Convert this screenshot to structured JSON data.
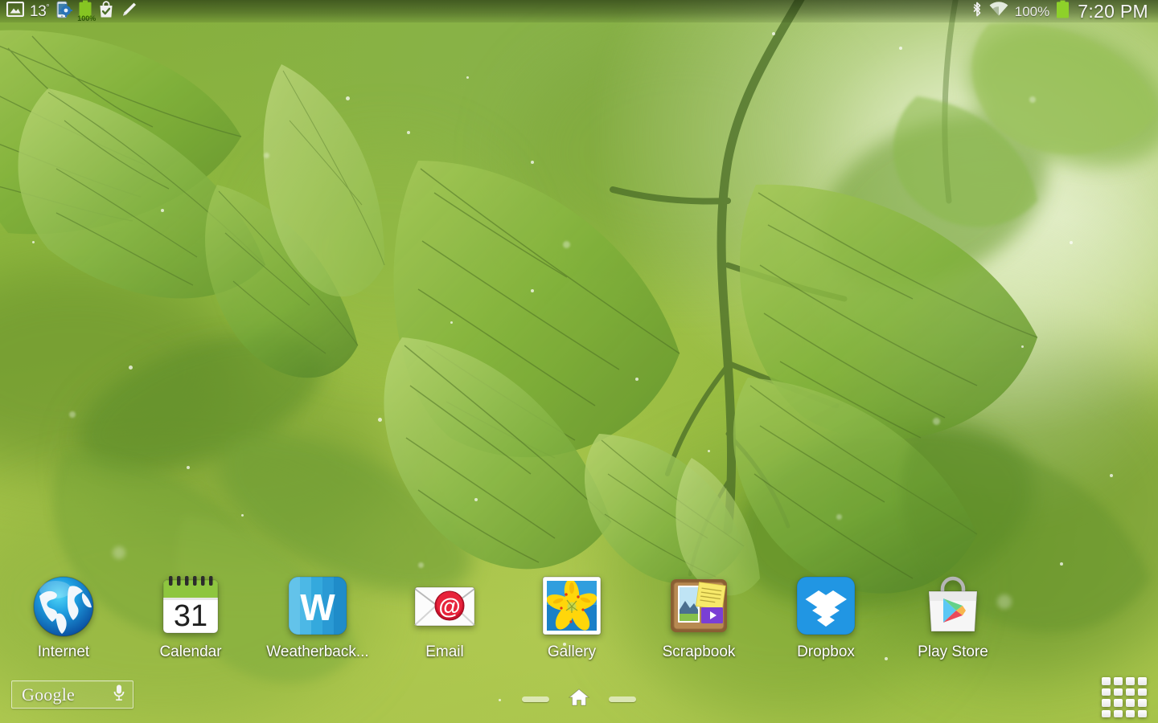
{
  "screen": {
    "device_type": "android-tablet-home-screen",
    "wallpaper_description": "blurred green leaves with backlight and dust particles"
  },
  "status_bar": {
    "left_icons": [
      {
        "name": "image-icon",
        "label": "picture"
      },
      {
        "name": "device-settings-icon",
        "label": "software update"
      },
      {
        "name": "battery-full-icon",
        "label": "battery"
      },
      {
        "name": "play-store-update-icon",
        "label": "app update available"
      },
      {
        "name": "pen-icon",
        "label": "s-pen"
      }
    ],
    "temperature": "13",
    "temperature_unit": "°",
    "battery_level_badge": "100%",
    "right_icons": [
      {
        "name": "bluetooth-icon",
        "label": "bluetooth"
      },
      {
        "name": "wifi-icon",
        "label": "wi-fi"
      }
    ],
    "battery_percent": "100%",
    "clock": "7:20 PM"
  },
  "apps": [
    {
      "label": "Internet",
      "icon": "internet-icon"
    },
    {
      "label": "Calendar",
      "icon": "calendar-icon",
      "day": "31"
    },
    {
      "label": "Weatherback...",
      "icon": "weatherback-icon",
      "glyph": "W"
    },
    {
      "label": "Email",
      "icon": "email-icon",
      "glyph": "@"
    },
    {
      "label": "Gallery",
      "icon": "gallery-icon"
    },
    {
      "label": "Scrapbook",
      "icon": "scrapbook-icon"
    },
    {
      "label": "Dropbox",
      "icon": "dropbox-icon"
    },
    {
      "label": "Play Store",
      "icon": "play-store-icon"
    }
  ],
  "search_widget": {
    "label": "Google",
    "mic_icon": "microphone-icon"
  },
  "page_indicator": {
    "pages": 3,
    "current_page": 2,
    "home_icon": "home-icon"
  },
  "apps_drawer": {
    "icon": "apps-grid-icon",
    "rows": 4,
    "cols": 4
  },
  "colors": {
    "wallpaper_green": "#8fb63a",
    "status_bar_overlay": "#1a2610",
    "battery_green": "#8ed12a",
    "dropbox_blue": "#2196e3",
    "weatherback_blue": "#2da4db",
    "email_red": "#e02233",
    "scrapbook_brown": "#9a6b3c",
    "calendar_green": "#8ec63f",
    "label_white": "#ffffff"
  }
}
